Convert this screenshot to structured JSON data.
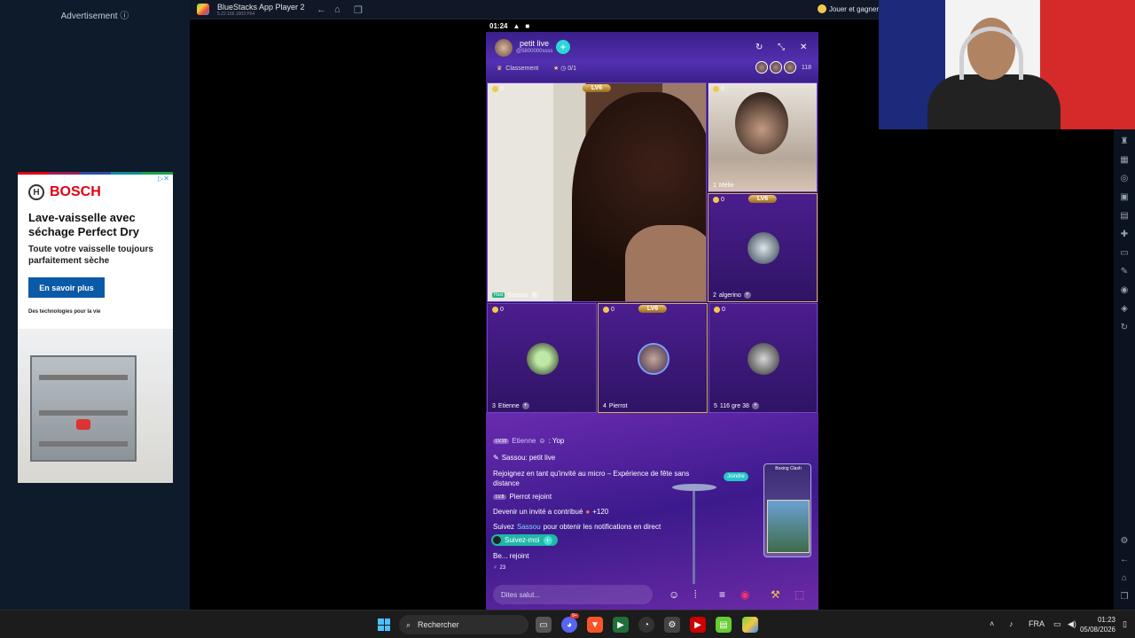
{
  "ad_column": {
    "label": "Advertisement",
    "info_icon": "info-icon",
    "brand": "BOSCH",
    "headline": "Lave-vaisselle avec séchage Perfect Dry",
    "subline": "Toute votre vaisselle toujours parfaitement sèche",
    "cta": "En savoir plus",
    "tagline": "Des technologies pour la vie"
  },
  "bluestacks": {
    "title": "BlueStacks App Player 2",
    "version": "5.22.166.1003 P64",
    "promo": "Jouer et gagner"
  },
  "phone": {
    "time": "01:24",
    "room_name": "petit live",
    "room_id": "@5800000ssss",
    "ranking_label": "Classement",
    "stars": "0/1",
    "viewer_count": "118",
    "seats": [
      {
        "coins": "0",
        "label": "Sassou",
        "host": "Host"
      },
      {
        "coins": "0",
        "index": "1",
        "label": "Mélie"
      },
      {
        "coins": "0",
        "index": "2",
        "label": "algerino",
        "level": "LV6"
      },
      {
        "coins": "0",
        "index": "3",
        "label": "Etienne"
      },
      {
        "coins": "0",
        "index": "4",
        "label": "Pierrot",
        "level": "LV6"
      },
      {
        "coins": "0",
        "index": "5",
        "label": "116 gre 38"
      }
    ],
    "host_level": "LV6",
    "chat": {
      "m1_level": "LV.10",
      "m1_name": "Etienne",
      "m1_text": ": Yop",
      "m2_text": "Sassou: petit live",
      "m3_text": "Rejoignez en tant qu'invité au micro – Expérience de fête sans distance",
      "m3_button": "Joindre",
      "m4_level": "LV.8",
      "m4_text": "Pierrot rejoint",
      "m5_text": "Devenir un invité a contribué",
      "m5_value": "+120",
      "m6_pre": "Suivez",
      "m6_name": "Sassou",
      "m6_post": "pour obtenir les notifications en direct",
      "follow_label": "Suivez-moi",
      "m7_text": "Be...  rejoint",
      "m7_count": "23"
    },
    "game_title": "Boxing Clash",
    "input_placeholder": "Dites salut..."
  },
  "taskbar": {
    "search": "Rechercher",
    "language": "FRA",
    "time": "01:23",
    "date": "05/08/2026",
    "discord_badge": "9+"
  }
}
